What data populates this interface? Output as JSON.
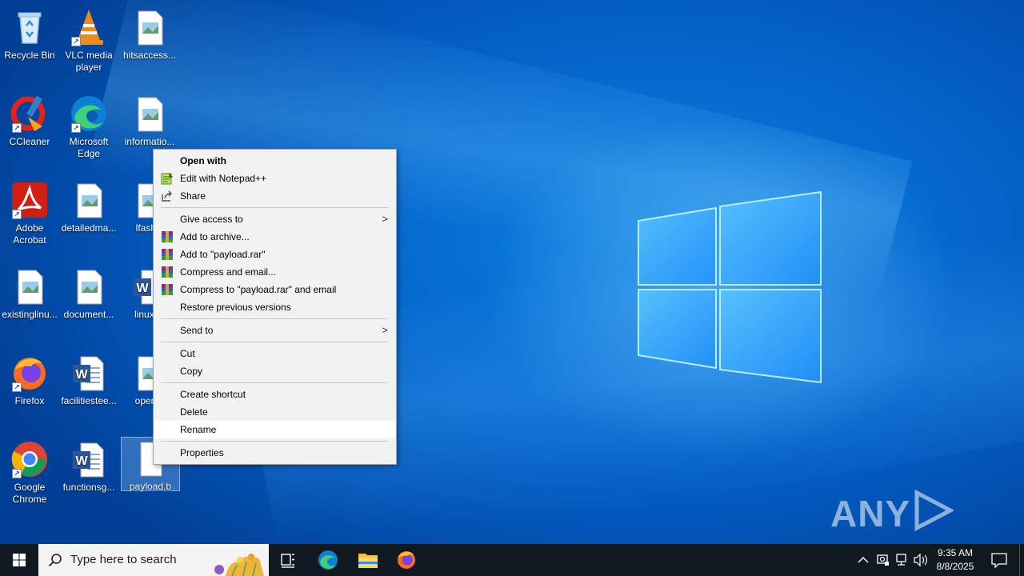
{
  "desktop": {
    "icons": [
      {
        "label": "Recycle Bin",
        "icon": "recycle-bin-icon"
      },
      {
        "label": "VLC media player",
        "icon": "vlc-icon"
      },
      {
        "label": "hitsaccess...",
        "icon": "image-file-icon"
      },
      {
        "label": "CCleaner",
        "icon": "ccleaner-icon"
      },
      {
        "label": "Microsoft Edge",
        "icon": "edge-icon"
      },
      {
        "label": "informatio...",
        "icon": "image-file-icon"
      },
      {
        "label": "Adobe Acrobat",
        "icon": "acrobat-icon"
      },
      {
        "label": "detailedma...",
        "icon": "image-file-icon"
      },
      {
        "label": "lfashio",
        "icon": "image-file-icon"
      },
      {
        "label": "existinglinu...",
        "icon": "image-file-icon"
      },
      {
        "label": "document...",
        "icon": "image-file-icon"
      },
      {
        "label": "linuxpa",
        "icon": "word-doc-icon"
      },
      {
        "label": "Firefox",
        "icon": "firefox-icon"
      },
      {
        "label": "facilitiestee...",
        "icon": "word-doc-icon"
      },
      {
        "label": "operati",
        "icon": "image-file-icon"
      },
      {
        "label": "Google Chrome",
        "icon": "chrome-icon"
      },
      {
        "label": "functionsg...",
        "icon": "word-doc-icon"
      },
      {
        "label": "payload.b",
        "icon": "blank-file-icon"
      }
    ]
  },
  "context_menu": {
    "open_with": "Open with",
    "edit_notepad": "Edit with Notepad++",
    "share": "Share",
    "give_access": "Give access to",
    "add_archive": "Add to archive...",
    "add_rar": "Add to \"payload.rar\"",
    "compress_email": "Compress and email...",
    "compress_rar_email": "Compress to \"payload.rar\" and email",
    "restore_versions": "Restore previous versions",
    "send_to": "Send to",
    "cut": "Cut",
    "copy": "Copy",
    "create_shortcut": "Create shortcut",
    "delete": "Delete",
    "rename": "Rename",
    "properties": "Properties",
    "highlighted_item": "Rename"
  },
  "taskbar": {
    "search_placeholder": "Type here to search",
    "clock_time": "9:35 AM",
    "clock_date": "8/8/2025",
    "pinned": [
      "task-view-icon",
      "edge-icon",
      "file-explorer-icon",
      "firefox-icon"
    ]
  },
  "watermark": {
    "text_left": "ANY",
    "text_right": "RUN"
  },
  "colors": {
    "desktop_blue": "#0568cf",
    "taskbar": "#101820",
    "menu_bg": "#f2f2f2"
  }
}
